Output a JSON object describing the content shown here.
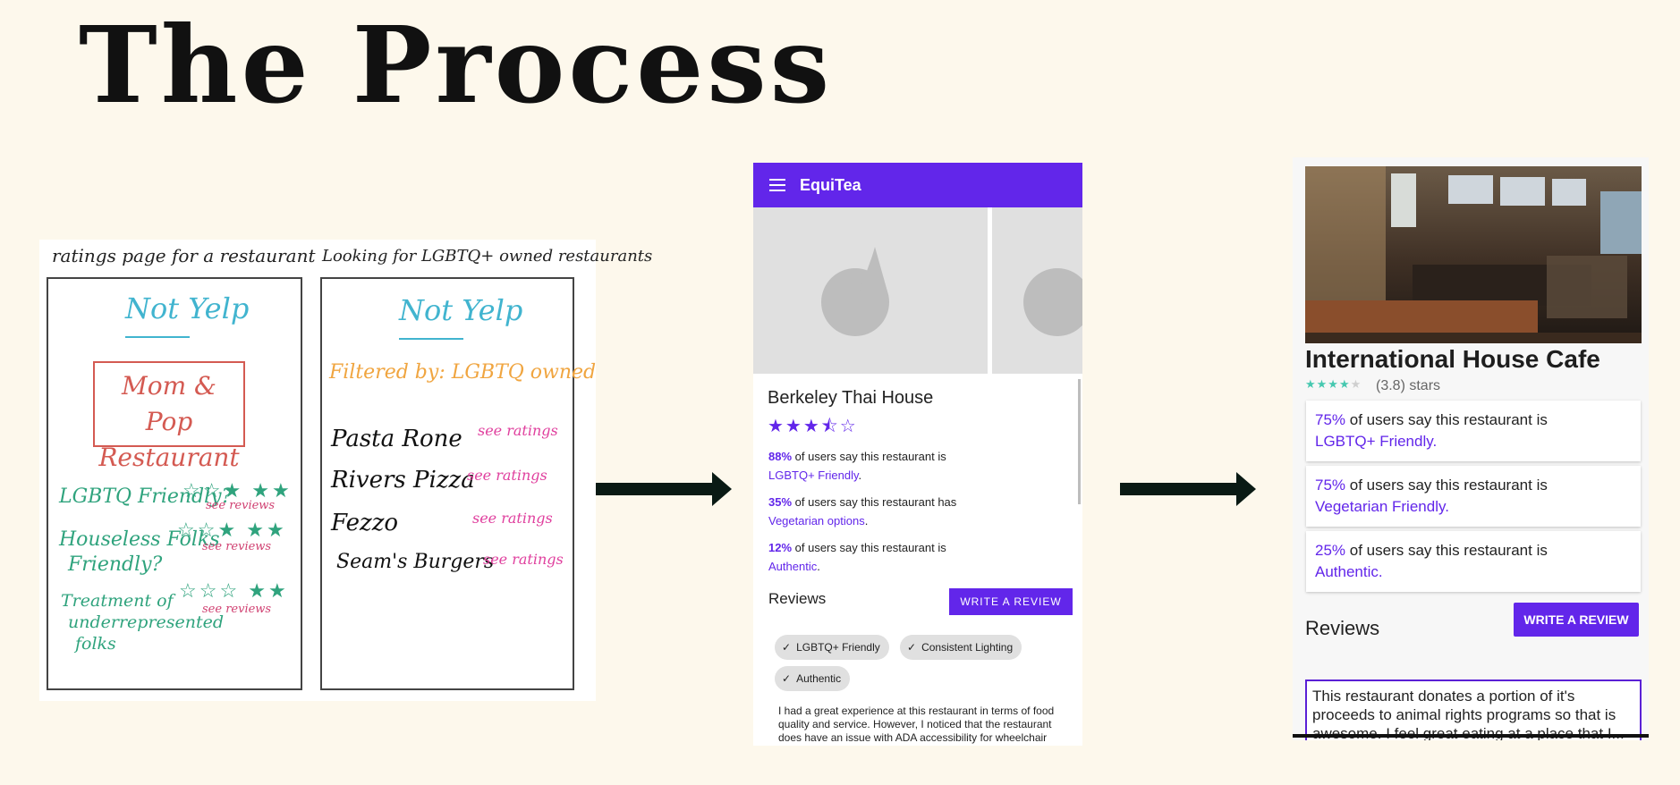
{
  "page": {
    "title": "The Process"
  },
  "sketch": {
    "left_caption": "ratings page for a restaurant",
    "right_caption": "Looking for LGBTQ+ owned restaurants",
    "logo": "Not Yelp",
    "restaurant_box": [
      "Mom & Pop",
      "Restaurant"
    ],
    "criteria": [
      {
        "label": [
          "LGBTQ Friendly?"
        ],
        "stars": "☆☆★ ★★",
        "reviews": "see reviews"
      },
      {
        "label": [
          "Houseless Folks",
          "Friendly?"
        ],
        "stars": "☆☆★ ★★",
        "reviews": "see reviews"
      },
      {
        "label": [
          "Treatment of",
          "underrepresented",
          "folks"
        ],
        "stars": "☆☆☆ ★★",
        "reviews": "see reviews"
      }
    ],
    "filter": "Filtered by: LGBTQ owned",
    "restaurants": [
      {
        "name": "Pasta Rone",
        "link": "see ratings"
      },
      {
        "name": "Rivers Pizza",
        "link": "see ratings"
      },
      {
        "name": "Fezzo",
        "link": "see ratings"
      },
      {
        "name": "Seam's Burgers",
        "link": "see ratings"
      }
    ]
  },
  "wireframe": {
    "app_name": "EquiTea",
    "restaurant_name": "Berkeley Thai House",
    "stars": "★★★⯪☆",
    "stats": [
      {
        "pct": "88%",
        "text": " of users say this restaurant is",
        "link": "LGBTQ+ Friendly",
        "end": "."
      },
      {
        "pct": "35%",
        "text": " of users say this restaurant has",
        "link": "Vegetarian options",
        "end": "."
      },
      {
        "pct": "12%",
        "text": " of users say this restaurant is",
        "link": "Authentic",
        "end": "."
      }
    ],
    "reviews_heading": "Reviews",
    "write_review": "WRITE A REVIEW",
    "chips": [
      "LGBTQ+ Friendly",
      "Consistent Lighting",
      "Authentic"
    ],
    "review_text": "I had a great experience at this restaurant in terms of food quality and service. However, I noticed that the restaurant does have an issue with ADA accessibility for wheelchair users and could..."
  },
  "final": {
    "restaurant_name": "International House Cafe",
    "stars_filled": "★★★★",
    "stars_empty": "★",
    "rating_text": "(3.8) stars",
    "stats": [
      {
        "pct": "75%",
        "text": " of users say this restaurant is",
        "link": "LGBTQ+ Friendly."
      },
      {
        "pct": "75%",
        "text": " of users say this restaurant is",
        "link": "Vegetarian Friendly."
      },
      {
        "pct": "25%",
        "text": " of users say this restaurant is",
        "link": "Authentic."
      }
    ],
    "reviews_heading": "Reviews",
    "write_review": "WRITE A REVIEW",
    "review_text": "This restaurant donates a portion of it's proceeds to animal rights programs so that is awesome. I feel great eating at a place that I..."
  },
  "colors": {
    "brand_purple": "#6226ea",
    "background": "#fdf8ec",
    "teal_stars": "#46c8b0"
  }
}
